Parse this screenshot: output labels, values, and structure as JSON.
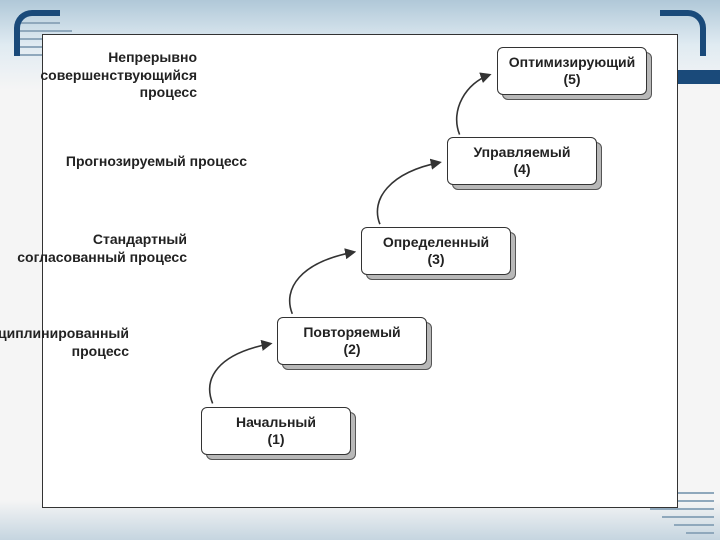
{
  "diagram": {
    "type": "maturity-staircase",
    "labels": {
      "l5": "Непрерывно\nсовершенствующийся\nпроцесс",
      "l4": "Прогнозируемый процесс",
      "l3": "Стандартный\nсогласованный процесс",
      "l2": "Дисциплинированный\nпроцесс"
    },
    "stages": {
      "s5": {
        "name": "Оптимизирующий",
        "num": "(5)"
      },
      "s4": {
        "name": "Управляемый",
        "num": "(4)"
      },
      "s3": {
        "name": "Определенный",
        "num": "(3)"
      },
      "s2": {
        "name": "Повторяемый",
        "num": "(2)"
      },
      "s1": {
        "name": "Начальный",
        "num": "(1)"
      }
    }
  }
}
